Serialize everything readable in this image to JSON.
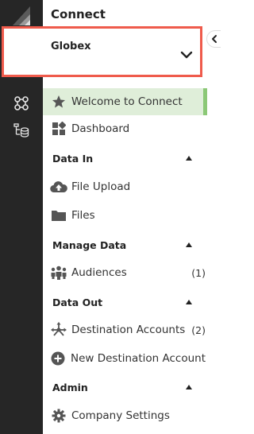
{
  "app": {
    "title": "Connect"
  },
  "org": {
    "name": "Globex"
  },
  "nav": {
    "welcome": "Welcome to Connect",
    "dashboard": "Dashboard",
    "data_in": "Data In",
    "file_upload": "File Upload",
    "files": "Files",
    "manage_data": "Manage Data",
    "audiences": "Audiences",
    "audiences_count": "(1)",
    "data_out": "Data Out",
    "destination_accounts": "Destination Accounts",
    "destination_accounts_count": "(2)",
    "new_destination_account": "New Destination Account",
    "admin": "Admin",
    "company_settings": "Company Settings"
  },
  "colors": {
    "rail": "#262626",
    "highlight_border": "#ef5b4c",
    "active_bg": "#dfeed9",
    "active_bar": "#8bc876"
  }
}
